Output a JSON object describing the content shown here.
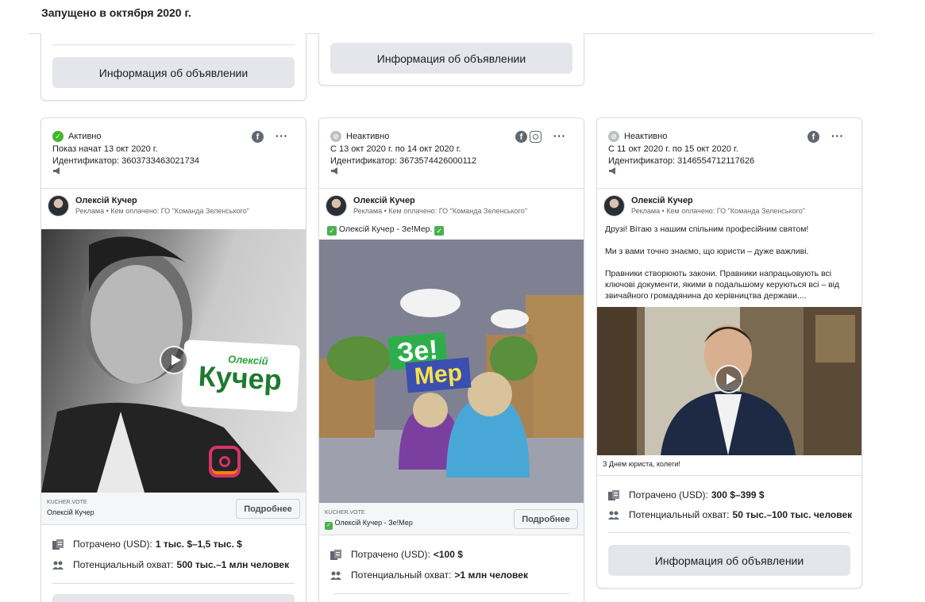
{
  "header": {
    "title": "Запущено в октября 2020 г."
  },
  "info_button_label": "Информация об объявлении",
  "cards": [
    {
      "status": "Активно",
      "status_type": "active",
      "line1": "Показ начат 13 окт 2020 г.",
      "line2": "Идентификатор: 3603733463021734",
      "platforms": [
        "facebook-icon"
      ],
      "advertiser": "Олексій Кучер",
      "advertiser_sub": "Реклама • Кем оплачено: ГО \"Команда Зеленського\"",
      "media_label": "Олексій",
      "media_title": "Кучер",
      "link_domain": "KUCHER.VOTE",
      "link_title": "Олексій Кучер",
      "link_button": "Подробнее",
      "spent_label": "Потрачено (USD):",
      "spent_value": "1 тыс. $–1,5 тыс. $",
      "reach_label": "Потенциальный охват:",
      "reach_value": "500 тыс.–1 млн человек"
    },
    {
      "status": "Неактивно",
      "status_type": "inactive",
      "line1": "С 13 окт 2020 г. по 14 окт 2020 г.",
      "line2": "Идентификатор: 3673574426000112",
      "platforms": [
        "facebook-icon",
        "instagram-icon"
      ],
      "advertiser": "Олексій Кучер",
      "advertiser_sub": "Реклама • Кем оплачено: ГО \"Команда Зеленського\"",
      "ad_text": "Олексій Кучер - Зе!Мер.",
      "media_sign1": "Зе!",
      "media_sign2": "Мер",
      "link_domain": "KUCHER.VOTE",
      "link_title": "Олексій Кучер - Зе!Мер",
      "link_button": "Подробнее",
      "spent_label": "Потрачено (USD):",
      "spent_value": "<100 $",
      "reach_label": "Потенциальный охват:",
      "reach_value": ">1 млн человек"
    },
    {
      "status": "Неактивно",
      "status_type": "inactive",
      "line1": "С 11 окт 2020 г. по 15 окт 2020 г.",
      "line2": "Идентификатор: 3146554712117626",
      "platforms": [
        "facebook-icon"
      ],
      "advertiser": "Олексій Кучер",
      "advertiser_sub": "Реклама • Кем оплачено: ГО \"Команда Зеленського\"",
      "ad_text_p1": "Друзі! Вітаю з нашим спільним професійним святом!",
      "ad_text_p2": "Ми з вами точно знаємо, що юристи – дуже важливі.",
      "ad_text_p3": "Правники створюють закони. Правники напрацьовують всі ключові документи, якими в подальшому керуються всі – від звичайного громадянина до керівництва держави....",
      "caption": "З Днем юриста, колеги!",
      "spent_label": "Потрачено (USD):",
      "spent_value": "300 $–399 $",
      "reach_label": "Потенциальный охват:",
      "reach_value": "50 тыс.–100 тыс. человек"
    }
  ]
}
